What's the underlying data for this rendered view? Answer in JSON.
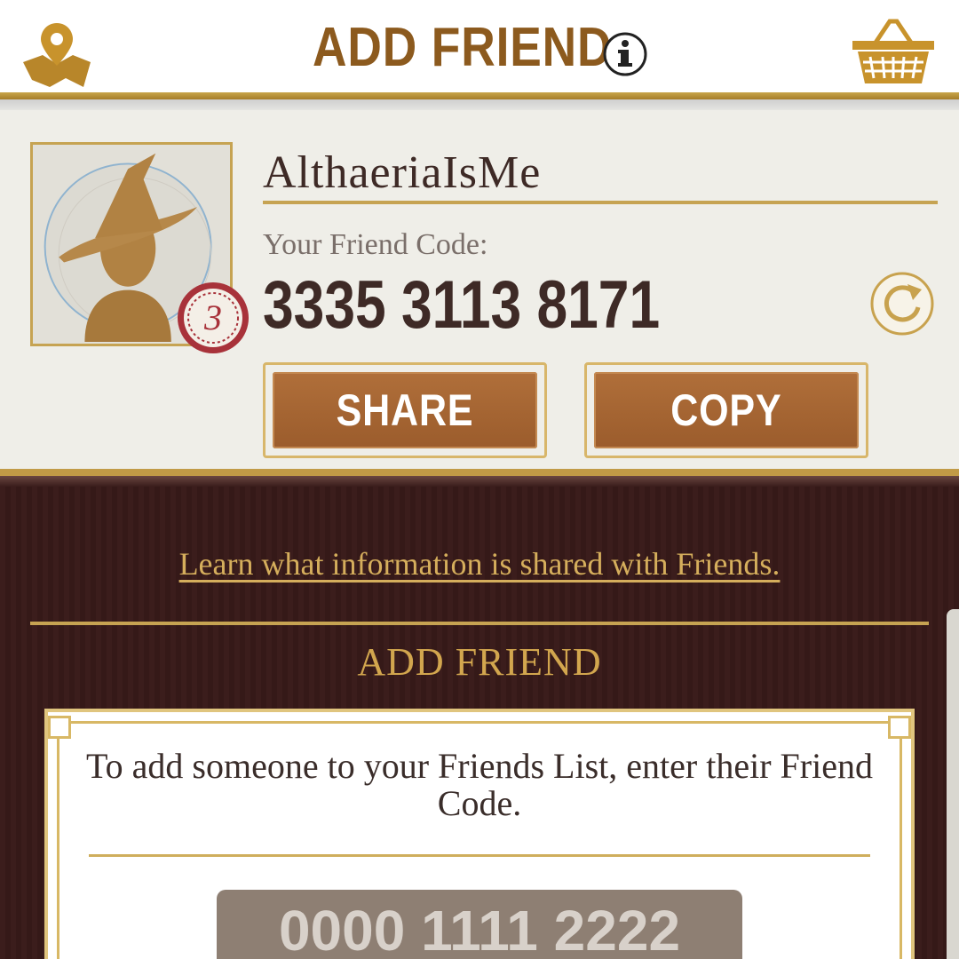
{
  "header": {
    "title": "ADD FRIEND",
    "map_icon": "map-pin-icon",
    "info_icon": "info-icon",
    "shop_icon": "basket-icon"
  },
  "profile": {
    "username": "AlthaeriaIsMe",
    "code_label": "Your Friend Code:",
    "friend_code": "3335 3113 8171",
    "level": "3",
    "share_label": "SHARE",
    "copy_label": "COPY"
  },
  "info_link": "Learn what information is shared with Friends.",
  "add_friend": {
    "title": "ADD FRIEND",
    "instructions": "To add someone to your Friends List, enter their Friend Code.",
    "input_placeholder": "0000 1111 2222"
  },
  "colors": {
    "gold": "#c6a352",
    "brown_title": "#8c5a1e",
    "button_brown": "#a5652f",
    "dark_bg": "#3a1d1b",
    "level_red": "#a8323a"
  }
}
